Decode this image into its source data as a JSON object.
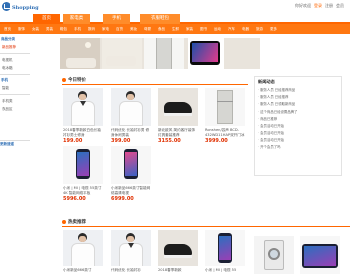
{
  "brand": {
    "logo_text": "Shopping"
  },
  "top_links": {
    "welcome": "你好欢迎",
    "login": "登录",
    "register": "注册",
    "cart": "会员"
  },
  "tabs": [
    "首页",
    "家电类",
    "手机",
    "衣服鞋包"
  ],
  "categories": [
    "首页",
    "服饰",
    "女装",
    "男装",
    "鞋包",
    "手机",
    "数码",
    "家电",
    "百货",
    "美妆",
    "母婴",
    "食品",
    "生鲜",
    "家装",
    "图书",
    "运动",
    "汽车",
    "电器",
    "旅游",
    "更多"
  ],
  "sidebar": {
    "head1": "商品分类",
    "items1": [
      "新品推荐",
      "",
      "电视机",
      "电冰箱"
    ],
    "head2": "手机",
    "items2": [
      "智能",
      "",
      "手机类",
      "衣品区"
    ],
    "foot": "更新速递"
  },
  "sections": {
    "today": "今日特价",
    "hot": "热卖推荐"
  },
  "products": [
    {
      "name": "2018春季新款白色长袖衬衫男士修身",
      "price": "199.00"
    },
    {
      "name": "代码优化 长袖衬衫男 修身休闲男装",
      "price": "399.00"
    },
    {
      "name": "新北欧风 简约客厅装饰灯具套装推荐",
      "price": "3155.00"
    },
    {
      "name": "Ronshen/容声 BCD-432WD11HAP双开门冰箱",
      "price": "3999.00"
    },
    {
      "name": "小米 | MI | 电视 55英寸 4K 智能网络平板",
      "price": "5996.00"
    },
    {
      "name": "小米新品666英寸智能网络高清电视",
      "price": "6999.00"
    }
  ],
  "hot_products": [
    {
      "name": "小米新品666英寸"
    },
    {
      "name": "代码优化 长袖衬衫"
    },
    {
      "name": "2018春季新款"
    },
    {
      "name": "小米 | MI | 电视 55"
    }
  ],
  "news": {
    "title": "新闻动态",
    "items": [
      "服务人员 已经推荐商品",
      "服务人员 已经推荐",
      "服务人员 已领取新商品",
      "这个商品已经设置品牌了",
      "商品已推荐",
      "会员活动已开始",
      "会员活动已开始",
      "会员活动已开始",
      "开个会员了吗"
    ]
  },
  "colors": {
    "accent": "#ff6600",
    "price": "#e03000",
    "brand": "#2f6fb5"
  }
}
